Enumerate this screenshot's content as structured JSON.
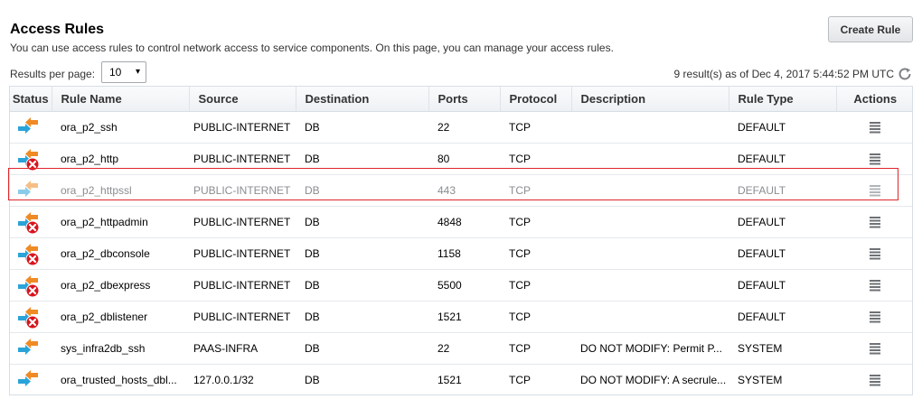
{
  "header": {
    "title": "Access Rules",
    "description": "You can use access rules to control network access to service components. On this page, you can manage your access rules.",
    "create_rule_label": "Create Rule"
  },
  "toolbar": {
    "results_per_page_label": "Results per page:",
    "results_per_page_value": "10",
    "results_status": "9 result(s) as of Dec 4, 2017 5:44:52 PM UTC"
  },
  "table": {
    "columns": [
      "Status",
      "Rule Name",
      "Source",
      "Destination",
      "Ports",
      "Protocol",
      "Description",
      "Rule Type",
      "Actions"
    ],
    "rows": [
      {
        "status": "enabled",
        "name": "ora_p2_ssh",
        "source": "PUBLIC-INTERNET",
        "destination": "DB",
        "ports": "22",
        "protocol": "TCP",
        "description": "",
        "type": "DEFAULT"
      },
      {
        "status": "disabled",
        "name": "ora_p2_http",
        "source": "PUBLIC-INTERNET",
        "destination": "DB",
        "ports": "80",
        "protocol": "TCP",
        "description": "",
        "type": "DEFAULT"
      },
      {
        "status": "pending",
        "name": "ora_p2_httpssl",
        "source": "PUBLIC-INTERNET",
        "destination": "DB",
        "ports": "443",
        "protocol": "TCP",
        "description": "",
        "type": "DEFAULT"
      },
      {
        "status": "disabled",
        "name": "ora_p2_httpadmin",
        "source": "PUBLIC-INTERNET",
        "destination": "DB",
        "ports": "4848",
        "protocol": "TCP",
        "description": "",
        "type": "DEFAULT"
      },
      {
        "status": "disabled",
        "name": "ora_p2_dbconsole",
        "source": "PUBLIC-INTERNET",
        "destination": "DB",
        "ports": "1158",
        "protocol": "TCP",
        "description": "",
        "type": "DEFAULT"
      },
      {
        "status": "disabled",
        "name": "ora_p2_dbexpress",
        "source": "PUBLIC-INTERNET",
        "destination": "DB",
        "ports": "5500",
        "protocol": "TCP",
        "description": "",
        "type": "DEFAULT"
      },
      {
        "status": "disabled",
        "name": "ora_p2_dblistener",
        "source": "PUBLIC-INTERNET",
        "destination": "DB",
        "ports": "1521",
        "protocol": "TCP",
        "description": "",
        "type": "DEFAULT"
      },
      {
        "status": "enabled",
        "name": "sys_infra2db_ssh",
        "source": "PAAS-INFRA",
        "destination": "DB",
        "ports": "22",
        "protocol": "TCP",
        "description": "DO NOT MODIFY: Permit P...",
        "type": "SYSTEM"
      },
      {
        "status": "enabled",
        "name": "ora_trusted_hosts_dbl...",
        "source": "127.0.0.1/32",
        "destination": "DB",
        "ports": "1521",
        "protocol": "TCP",
        "description": "DO NOT MODIFY: A secrule...",
        "type": "SYSTEM"
      }
    ]
  },
  "icons": {
    "status_enabled": "arrows-exchange-icon",
    "status_disabled": "arrows-exchange-disabled-icon",
    "actions": "actions-menu-icon",
    "refresh": "refresh-icon"
  },
  "colors": {
    "arrow_orange": "#f08a24",
    "arrow_blue": "#2aa3d8",
    "disabled_red": "#d9141c",
    "highlight_red": "#e0262b"
  }
}
